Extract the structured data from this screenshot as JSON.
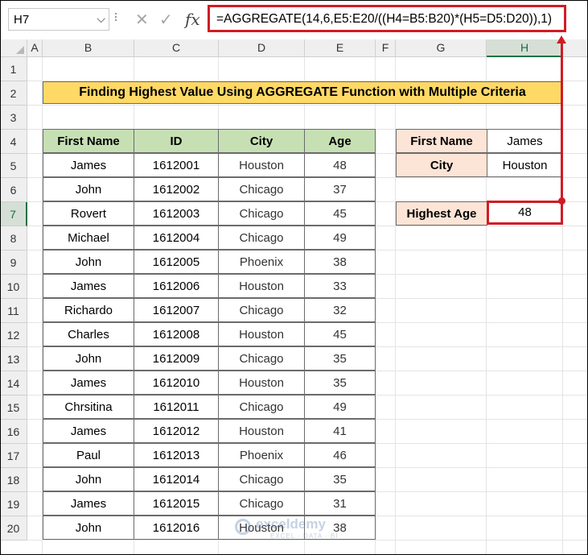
{
  "formula_bar": {
    "name_box": "H7",
    "cancel_symbol": "✕",
    "enter_symbol": "✓",
    "fx_symbol": "fx",
    "formula": "=AGGREGATE(14,6,E5:E20/((H4=B5:B20)*(H5=D5:D20)),1)"
  },
  "columns": [
    "A",
    "B",
    "C",
    "D",
    "E",
    "F",
    "G",
    "H"
  ],
  "rows": [
    "1",
    "2",
    "3",
    "4",
    "5",
    "6",
    "7",
    "8",
    "9",
    "10",
    "11",
    "12",
    "13",
    "14",
    "15",
    "16",
    "17",
    "18",
    "19",
    "20"
  ],
  "selected_cell": "H7",
  "title": "Finding Highest Value Using AGGREGATE Function with Multiple Criteria",
  "table": {
    "headers": [
      "First Name",
      "ID",
      "City",
      "Age"
    ],
    "rows": [
      [
        "James",
        "1612001",
        "Houston",
        "48"
      ],
      [
        "John",
        "1612002",
        "Chicago",
        "37"
      ],
      [
        "Rovert",
        "1612003",
        "Chicago",
        "45"
      ],
      [
        "Michael",
        "1612004",
        "Chicago",
        "49"
      ],
      [
        "John",
        "1612005",
        "Phoenix",
        "38"
      ],
      [
        "James",
        "1612006",
        "Houston",
        "33"
      ],
      [
        "Richardo",
        "1612007",
        "Chicago",
        "32"
      ],
      [
        "Charles",
        "1612008",
        "Houston",
        "45"
      ],
      [
        "John",
        "1612009",
        "Chicago",
        "35"
      ],
      [
        "James",
        "1612010",
        "Houston",
        "35"
      ],
      [
        "Chrsitina",
        "1612011",
        "Chicago",
        "49"
      ],
      [
        "James",
        "1612012",
        "Houston",
        "41"
      ],
      [
        "Paul",
        "1612013",
        "Phoenix",
        "46"
      ],
      [
        "John",
        "1612014",
        "Chicago",
        "35"
      ],
      [
        "James",
        "1612015",
        "Chicago",
        "31"
      ],
      [
        "John",
        "1612016",
        "Houston",
        "38"
      ]
    ]
  },
  "criteria": {
    "first_name_label": "First Name",
    "first_name_value": "James",
    "city_label": "City",
    "city_value": "Houston"
  },
  "result": {
    "label": "Highest Age",
    "value": "48"
  },
  "watermark": {
    "line1": "exceldemy",
    "line2": "EXCEL · DATA · BI"
  },
  "colors": {
    "highlight_red": "#d01c24",
    "title_fill": "#ffd966",
    "header_fill": "#c6e0b4",
    "label_fill": "#fce4d6",
    "excel_green": "#1e7145"
  }
}
